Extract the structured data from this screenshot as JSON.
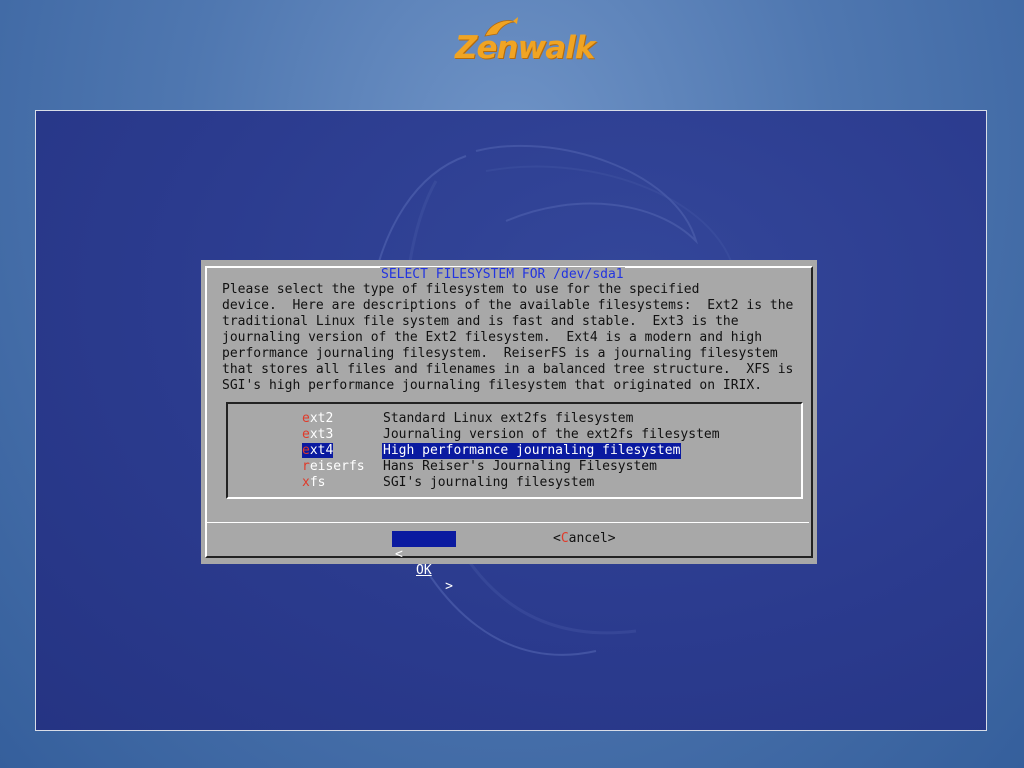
{
  "brand": {
    "logo_text": "Zenwalk",
    "color": "#f0a423"
  },
  "dialog": {
    "title": "SELECT FILESYSTEM FOR /dev/sda1",
    "description_lines": [
      "Please select the type of filesystem to use for the specified",
      "device.  Here are descriptions of the available filesystems:  Ext2 is the",
      "traditional Linux file system and is fast and stable.  Ext3 is the",
      "journaling version of the Ext2 filesystem.  Ext4 is a modern and high",
      "performance journaling filesystem.  ReiserFS is a journaling filesystem",
      "that stores all files and filenames in a balanced tree structure.  XFS is",
      "SGI's high performance journaling filesystem that originated on IRIX."
    ],
    "options": [
      {
        "hotkey": "e",
        "rest": "xt2",
        "description": "Standard Linux ext2fs filesystem"
      },
      {
        "hotkey": "e",
        "rest": "xt3",
        "description": "Journaling version of the ext2fs filesystem"
      },
      {
        "hotkey": "e",
        "rest": "xt4",
        "description": "High performance journaling filesystem"
      },
      {
        "hotkey": "r",
        "rest": "eiserfs",
        "description": "Hans Reiser's Journaling Filesystem"
      },
      {
        "hotkey": "x",
        "rest": "fs",
        "description": "SGI's journaling filesystem"
      }
    ],
    "selected_index": 2,
    "buttons": {
      "ok": {
        "left": "<",
        "label": "OK",
        "right": ">"
      },
      "cancel": {
        "left": "<",
        "hotkey": "C",
        "rest": "ancel",
        "right": ">"
      }
    }
  },
  "colors": {
    "selection": "#0a1aa0",
    "hotkey": "#e03a2a",
    "title": "#2234e0",
    "dialog_bg": "#a8a8a8",
    "screen_bg": "#2b3b8e"
  }
}
